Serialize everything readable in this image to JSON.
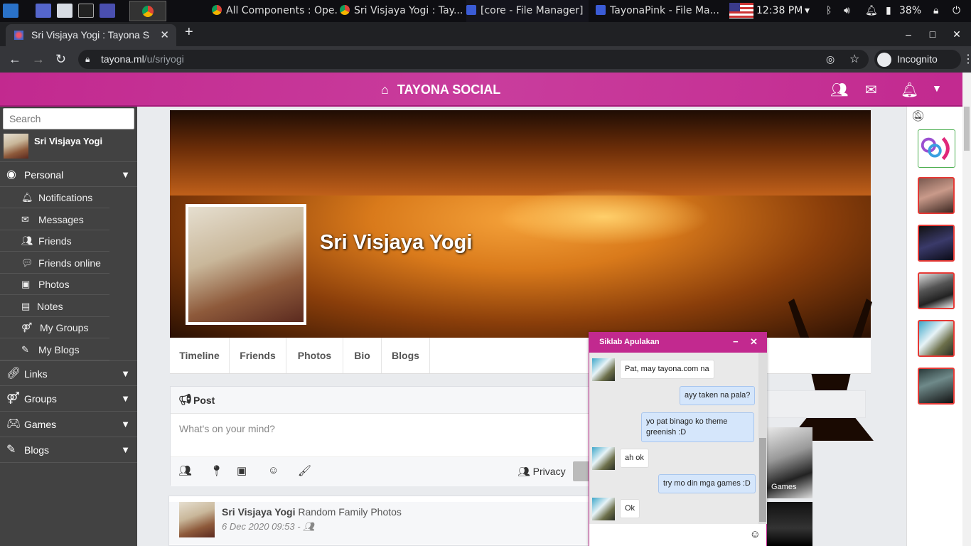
{
  "taskbar": {
    "tasks": [
      {
        "label": "All Components : Ope..."
      },
      {
        "label": "Sri Visjaya Yogi : Tay..."
      },
      {
        "label": "[core - File Manager]"
      },
      {
        "label": "TayonaPink - File Ma..."
      }
    ],
    "clock": "12:38 PM",
    "battery": "38%"
  },
  "browser": {
    "tab_title": "Sri Visjaya Yogi : Tayona S",
    "url_host": "tayona.ml",
    "url_path": "/u/sriyogi",
    "incognito_label": "Incognito"
  },
  "site": {
    "brand": "TAYONA SOCIAL",
    "accent": "#c2298f"
  },
  "sidebar": {
    "search_placeholder": "Search",
    "user_name": "Sri Visjaya Yogi",
    "personal_label": "Personal",
    "personal_items": [
      {
        "label": "Notifications",
        "icon": "bell-icon"
      },
      {
        "label": "Messages",
        "icon": "envelope-icon"
      },
      {
        "label": "Friends",
        "icon": "users-icon"
      },
      {
        "label": "Friends online",
        "icon": "chat-icon"
      },
      {
        "label": "Photos",
        "icon": "image-icon"
      },
      {
        "label": "Notes",
        "icon": "note-icon"
      },
      {
        "label": "My Groups",
        "icon": "groups-icon"
      },
      {
        "label": "My Blogs",
        "icon": "edit-icon"
      }
    ],
    "sections": [
      {
        "label": "Links",
        "icon": "link-icon"
      },
      {
        "label": "Groups",
        "icon": "groups-icon"
      },
      {
        "label": "Games",
        "icon": "gamepad-icon"
      },
      {
        "label": "Blogs",
        "icon": "edit-icon"
      }
    ]
  },
  "profile": {
    "name": "Sri Visjaya Yogi",
    "tabs": [
      "Timeline",
      "Friends",
      "Photos",
      "Bio",
      "Blogs"
    ]
  },
  "post": {
    "header": "Post",
    "placeholder": "What's on your mind?",
    "privacy_label": "Privacy"
  },
  "feed": {
    "author": "Sri Visjaya Yogi",
    "action": "Random Family Photos",
    "date": "6 Dec 2020 09:53 -"
  },
  "thumb_caption": "Games",
  "chat": {
    "title": "Siklab Apulakan",
    "messages": [
      {
        "dir": "in",
        "text": "Pat, may tayona.com na"
      },
      {
        "dir": "out",
        "text": "ayy taken na pala?"
      },
      {
        "dir": "out",
        "text": "yo pat binago ko theme greenish :D"
      },
      {
        "dir": "in",
        "text": "ah ok"
      },
      {
        "dir": "out",
        "text": "try mo din mga games :D"
      },
      {
        "dir": "in",
        "text": "Ok"
      }
    ]
  }
}
